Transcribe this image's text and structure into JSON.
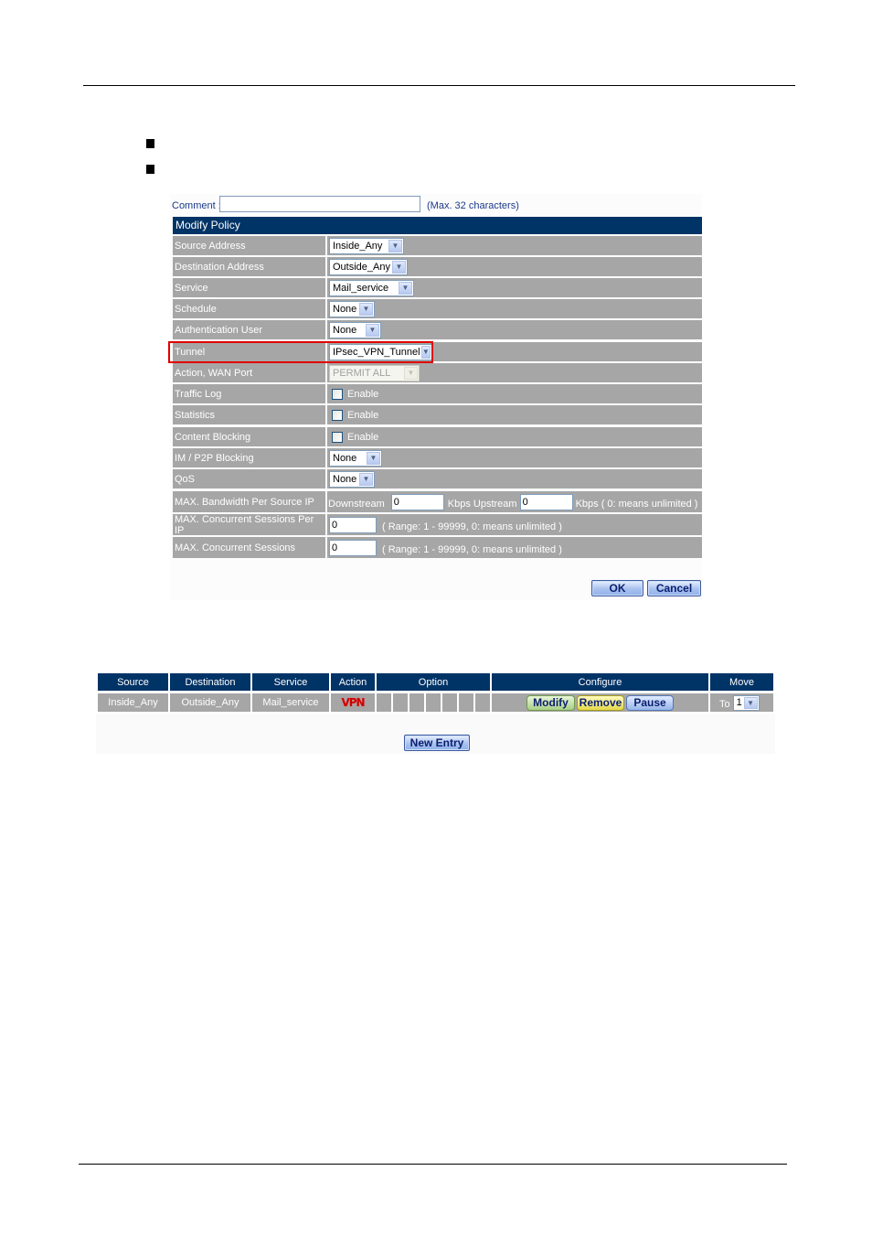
{
  "page": {
    "bullets": 2
  },
  "form": {
    "comment_label": "Comment :",
    "comment_value": "",
    "comment_hint": "(Max. 32 characters)",
    "title": "Modify Policy",
    "rows": {
      "source_address": {
        "label": "Source Address",
        "value": "Inside_Any"
      },
      "destination_address": {
        "label": "Destination Address",
        "value": "Outside_Any"
      },
      "service": {
        "label": "Service",
        "value": "Mail_service"
      },
      "schedule": {
        "label": "Schedule",
        "value": "None"
      },
      "authentication_user": {
        "label": "Authentication User",
        "value": "None"
      },
      "tunnel": {
        "label": "Tunnel",
        "value": "IPsec_VPN_Tunnel"
      },
      "action_wan_port": {
        "label": "Action, WAN Port",
        "value": "PERMIT ALL"
      },
      "traffic_log": {
        "label": "Traffic Log",
        "option": "Enable",
        "checked": false
      },
      "statistics": {
        "label": "Statistics",
        "option": "Enable",
        "checked": false
      },
      "content_blocking": {
        "label": "Content Blocking",
        "option": "Enable",
        "checked": false
      },
      "im_p2p_blocking": {
        "label": "IM / P2P Blocking",
        "value": "None"
      },
      "qos": {
        "label": "QoS",
        "value": "None"
      },
      "max_bandwidth": {
        "label": "MAX. Bandwidth Per Source IP",
        "downstream_label": "Downstream",
        "downstream_value": "0",
        "upstream_label": "Kbps Upstream",
        "upstream_value": "0",
        "hint": "Kbps ( 0: means unlimited )"
      },
      "max_sessions_per_ip": {
        "label": "MAX. Concurrent Sessions Per IP",
        "value": "0",
        "hint": "( Range: 1 - 99999, 0: means unlimited )"
      },
      "max_sessions": {
        "label": "MAX. Concurrent Sessions",
        "value": "0",
        "hint": "( Range: 1 - 99999, 0: means unlimited )"
      }
    },
    "ok_label": "OK",
    "cancel_label": "Cancel"
  },
  "policy_list": {
    "headers": [
      "Source",
      "Destination",
      "Service",
      "Action",
      "Option",
      "Configure",
      "Move"
    ],
    "rows": [
      {
        "source": "Inside_Any",
        "destination": "Outside_Any",
        "service": "Mail_service",
        "action_icon": "VPN",
        "option_cells": 7,
        "modify_label": "Modify",
        "remove_label": "Remove",
        "pause_label": "Pause",
        "move_label": "To",
        "move_value": "1"
      }
    ],
    "new_entry_label": "New Entry"
  },
  "colors": {
    "header_bg": "#003366",
    "row_bg": "#a6a6a6",
    "highlight": "#e00000",
    "vpn_icon": "#cc0000"
  }
}
